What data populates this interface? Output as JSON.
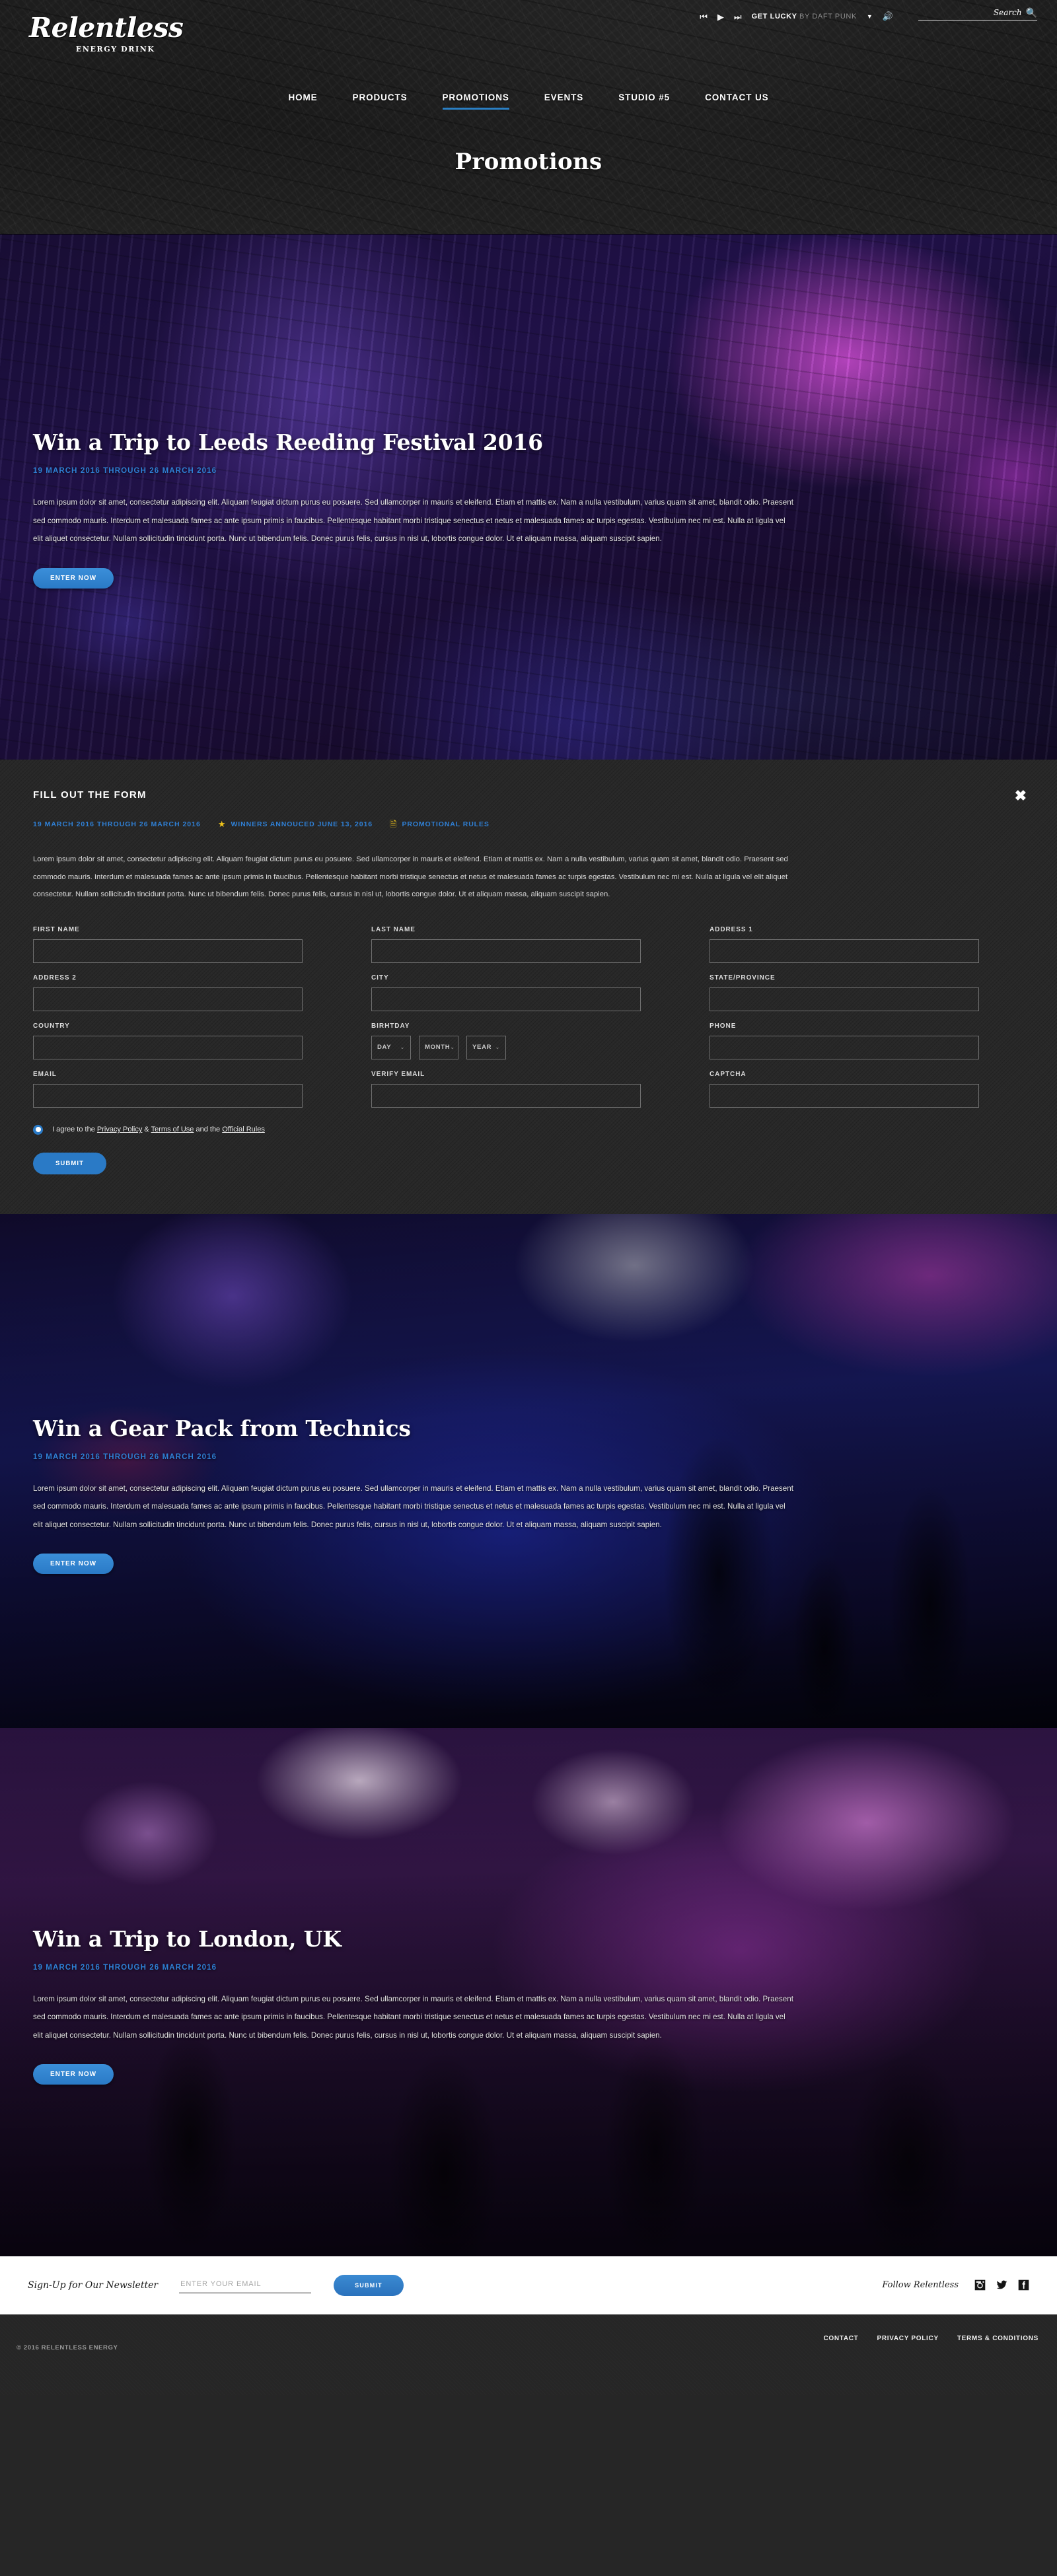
{
  "brand": {
    "logo_main": "Relentless",
    "logo_sub": "ENERGY DRINK"
  },
  "player": {
    "prev_icon": "skip-previous-icon",
    "play_icon": "play-icon",
    "next_icon": "skip-next-icon",
    "track_title": "GET LUCKY",
    "track_artist": "BY DAFT PUNK",
    "caret_icon": "chevron-down-icon",
    "volume_icon": "volume-icon"
  },
  "search": {
    "label": "Search",
    "icon": "search-icon"
  },
  "nav": {
    "items": [
      {
        "label": "HOME",
        "active": false
      },
      {
        "label": "PRODUCTS",
        "active": false
      },
      {
        "label": "PROMOTIONS",
        "active": true
      },
      {
        "label": "EVENTS",
        "active": false
      },
      {
        "label": "STUDIO #5",
        "active": false
      },
      {
        "label": "CONTACT US",
        "active": false
      }
    ],
    "active_accent": "#2a7fc4"
  },
  "page_title": "Promotions",
  "body_copy": "Lorem ipsum dolor sit amet, consectetur adipiscing elit. Aliquam feugiat dictum purus eu posuere. Sed ullamcorper in mauris et eleifend. Etiam et mattis ex. Nam a nulla vestibulum, varius quam sit amet, blandit odio. Praesent sed commodo mauris. Interdum et malesuada fames ac ante ipsum primis in faucibus. Pellentesque habitant morbi tristique senectus et netus et malesuada fames ac turpis egestas. Vestibulum nec mi est. Nulla at ligula vel elit aliquet consectetur. Nullam sollicitudin tincidunt porta. Nunc ut bibendum felis. Donec purus felis, cursus in nisl ut, lobortis congue dolor. Ut et aliquam massa, aliquam suscipit sapien.",
  "promotions": [
    {
      "title": "Win a Trip to Leeds Reeding Festival 2016",
      "dates": "19 MARCH 2016 THROUGH 26 MARCH 2016",
      "cta": "ENTER NOW"
    },
    {
      "title": "Win a Gear Pack from Technics",
      "dates": "19 MARCH 2016 THROUGH 26 MARCH 2016",
      "cta": "ENTER NOW"
    },
    {
      "title": "Win a Trip to London, UK",
      "dates": "19 MARCH 2016 THROUGH 26 MARCH 2016",
      "cta": "ENTER NOW"
    }
  ],
  "form": {
    "heading": "FILL OUT THE FORM",
    "close_icon": "close-icon",
    "dates": "19 MARCH 2016 THROUGH 26 MARCH 2016",
    "winners_icon": "star-icon",
    "winners_text": "WINNERS ANNOUCED JUNE 13, 2016",
    "rules_icon": "document-icon",
    "rules_text": "PROMOTIONAL RULES",
    "accent_yellow": "#f2c61b",
    "accent_blue": "#2f80d6",
    "fields": {
      "first_name": {
        "label": "FIRST NAME",
        "value": ""
      },
      "last_name": {
        "label": "LAST NAME",
        "value": ""
      },
      "address_1": {
        "label": "ADDRESS 1",
        "value": ""
      },
      "address_2": {
        "label": "ADDRESS 2",
        "value": ""
      },
      "city": {
        "label": "CITY",
        "value": ""
      },
      "state_province": {
        "label": "STATE/PROVINCE",
        "value": ""
      },
      "country": {
        "label": "COUNTRY",
        "value": ""
      },
      "birthday": {
        "label": "BIRHTDAY",
        "day": "DAY",
        "month": "MONTH",
        "year": "YEAR"
      },
      "phone": {
        "label": "PHONE",
        "value": ""
      },
      "email": {
        "label": "EMAIL",
        "value": ""
      },
      "verify_email": {
        "label": "VERIFY EMAIL",
        "value": ""
      },
      "captcha": {
        "label": "CAPTCHA",
        "value": ""
      }
    },
    "agree": {
      "prefix": "I agree to the ",
      "link_privacy": "Privacy Policy",
      "amp": " & ",
      "link_terms": "Terms of Use",
      "middle": " and the ",
      "link_rules": "Official Rules"
    },
    "submit_label": "SUBMIT"
  },
  "newsletter": {
    "label": "Sign-Up for Our Newsletter",
    "placeholder": "ENTER YOUR EMAIL",
    "value": "",
    "submit_label": "SUBMIT",
    "follow_label": "Follow Relentless",
    "social": [
      {
        "name": "instagram-icon"
      },
      {
        "name": "twitter-icon"
      },
      {
        "name": "facebook-icon"
      }
    ]
  },
  "footer": {
    "copyright": "© 2016 RELENTLESS ENERGY",
    "links": [
      "CONTACT",
      "PRIVACY POLICY",
      "TERMS & CONDITIONS"
    ]
  }
}
